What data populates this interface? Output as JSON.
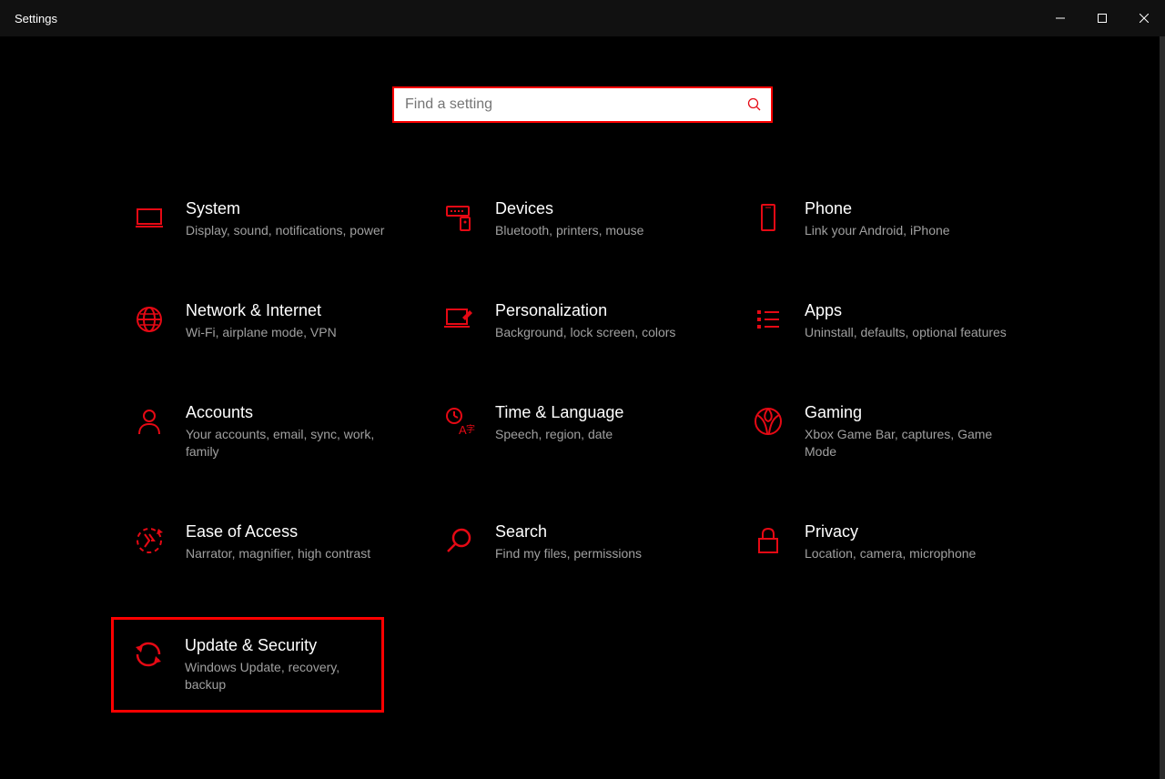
{
  "window": {
    "title": "Settings"
  },
  "search": {
    "placeholder": "Find a setting"
  },
  "tiles": [
    {
      "title": "System",
      "desc": "Display, sound, notifications, power"
    },
    {
      "title": "Devices",
      "desc": "Bluetooth, printers, mouse"
    },
    {
      "title": "Phone",
      "desc": "Link your Android, iPhone"
    },
    {
      "title": "Network & Internet",
      "desc": "Wi-Fi, airplane mode, VPN"
    },
    {
      "title": "Personalization",
      "desc": "Background, lock screen, colors"
    },
    {
      "title": "Apps",
      "desc": "Uninstall, defaults, optional features"
    },
    {
      "title": "Accounts",
      "desc": "Your accounts, email, sync, work, family"
    },
    {
      "title": "Time & Language",
      "desc": "Speech, region, date"
    },
    {
      "title": "Gaming",
      "desc": "Xbox Game Bar, captures, Game Mode"
    },
    {
      "title": "Ease of Access",
      "desc": "Narrator, magnifier, high contrast"
    },
    {
      "title": "Search",
      "desc": "Find my files, permissions"
    },
    {
      "title": "Privacy",
      "desc": "Location, camera, microphone"
    },
    {
      "title": "Update & Security",
      "desc": "Windows Update, recovery, backup"
    }
  ]
}
